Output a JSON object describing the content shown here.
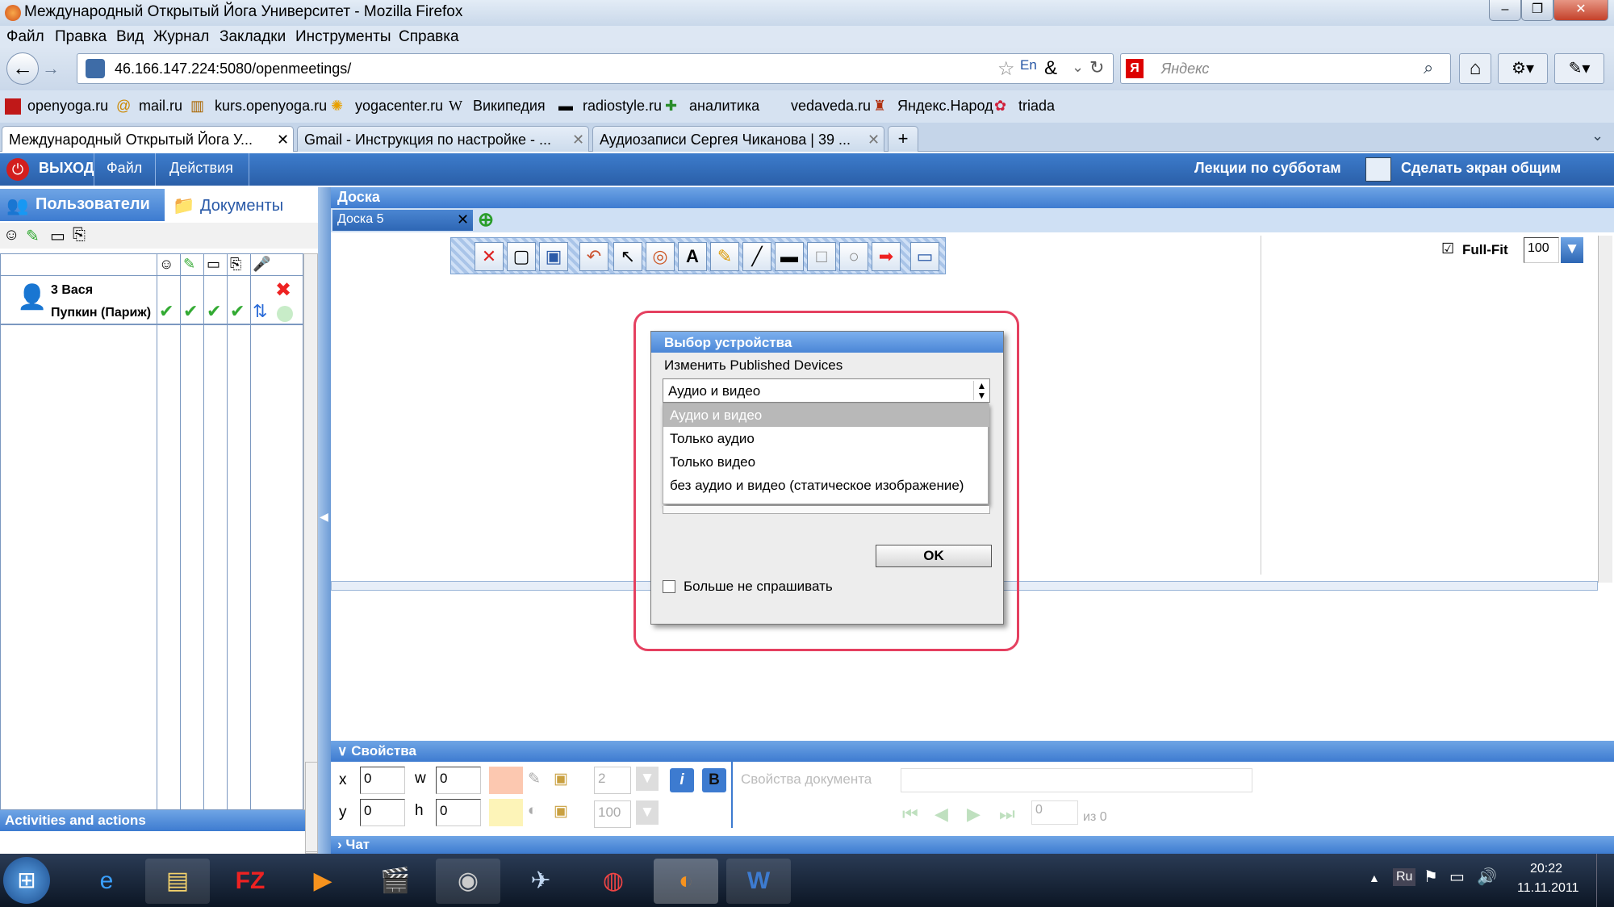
{
  "window": {
    "title": "Международный Открытый Йога Университет - Mozilla Firefox",
    "min": "–",
    "max": "❐",
    "close": "✕"
  },
  "menu": [
    "Файл",
    "Правка",
    "Вид",
    "Журнал",
    "Закладки",
    "Инструменты",
    "Справка"
  ],
  "nav": {
    "url": "46.166.147.224:5080/openmeetings/",
    "search_placeholder": "Яндекс",
    "lang": "En"
  },
  "bookmarks": [
    "openyoga.ru",
    "mail.ru",
    "kurs.openyoga.ru",
    "yogacenter.ru",
    "Википедия",
    "radiostyle.ru",
    "аналитика",
    "vedaveda.ru",
    "Яндекс.Народ",
    "triada"
  ],
  "tabs": [
    "Международный Открытый Йога У...",
    "Gmail - Инструкция по настройке - ...",
    "Аудиозаписи Сергея Чиканова | 39 ..."
  ],
  "app": {
    "exit": "ВЫХОД",
    "file": "Файл",
    "actions": "Действия",
    "lecture": "Лекции по субботам",
    "share": "Сделать экран общим"
  },
  "left": {
    "users_tab": "Пользователи",
    "docs_tab": "Документы",
    "user_line1": "3 Вася",
    "user_line2": "Пупкин (Париж)",
    "activities": "Activities and actions"
  },
  "board": {
    "header": "Доска",
    "tab": "Доска 5",
    "fullfit": "Full-Fit",
    "zoom": "100"
  },
  "dialog": {
    "title": "Выбор устройства",
    "subtitle": "Изменить Published Devices",
    "selected": "Аудио и видео",
    "options": [
      "Аудио и видео",
      "Только аудио",
      "Только видео",
      "без аудио и видео (статическое изображение)"
    ],
    "ok": "OK",
    "dont_ask": "Больше не спрашивать"
  },
  "props": {
    "header": "Свойства",
    "x": "x",
    "y": "y",
    "w": "w",
    "h": "h",
    "x_val": "0",
    "y_val": "0",
    "w_val": "0",
    "h_val": "0",
    "line": "2",
    "opacity": "100",
    "doc_props": "Свойства документа",
    "page": "0",
    "of": "из 0",
    "italic": "i",
    "bold": "B"
  },
  "chat": {
    "header": "Чат"
  },
  "taskbar": {
    "lang": "Ru",
    "time": "20:22",
    "date": "11.11.2011"
  }
}
